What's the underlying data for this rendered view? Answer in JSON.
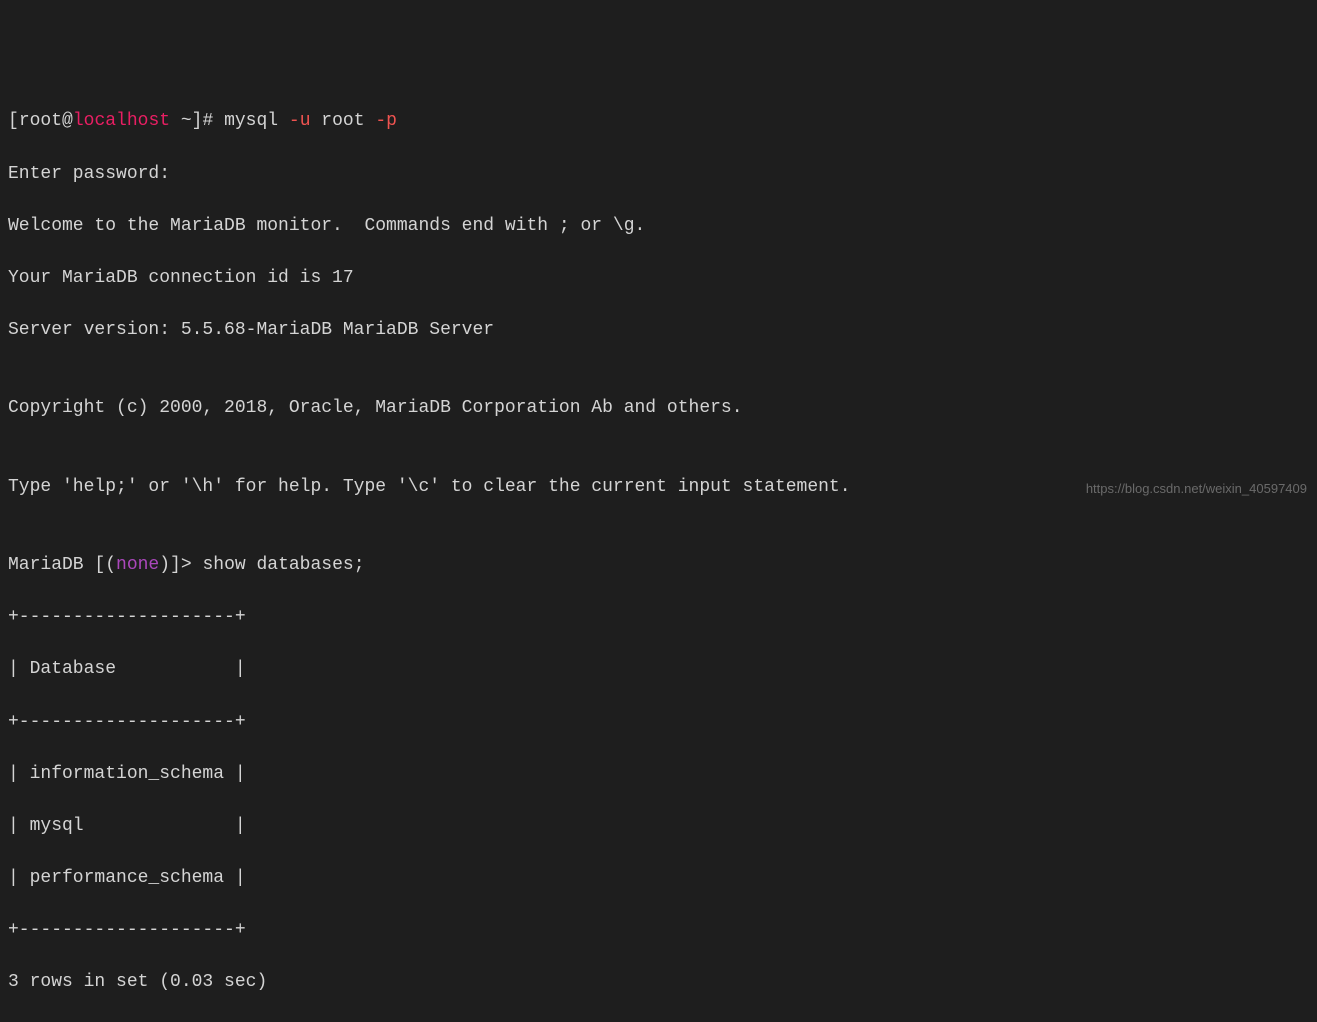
{
  "prompt": {
    "open": "[",
    "user": "root",
    "at": "@",
    "host": "localhost",
    "pathmark": " ~]# ",
    "cmd": "mysql ",
    "arg1": "-u",
    "mid": " root ",
    "arg2": "-p"
  },
  "pw": "Enter password:",
  "welcome": "Welcome to the MariaDB monitor.  Commands end with ; or \\g.",
  "connid": "Your MariaDB connection id is 17",
  "server": "Server version: 5.5.68-MariaDB MariaDB Server",
  "blank1": "",
  "copyright": "Copyright (c) 2000, 2018, Oracle, MariaDB Corporation Ab and others.",
  "blank2": "",
  "helpline": "Type 'help;' or '\\h' for help. Type '\\c' to clear the current input statement.",
  "blank3": "",
  "mp": {
    "pre": "MariaDB [(",
    "none": "none",
    "post": ")]> ",
    "stmt": "show databases;"
  },
  "tbl": {
    "border": "+--------------------+",
    "header": "| Database           |",
    "row1": "| information_schema |",
    "row2": "| mysql              |",
    "row3": "| performance_schema |"
  },
  "summary": "3 rows in set (0.03 sec)",
  "watermark": "https://blog.csdn.net/weixin_40597409"
}
